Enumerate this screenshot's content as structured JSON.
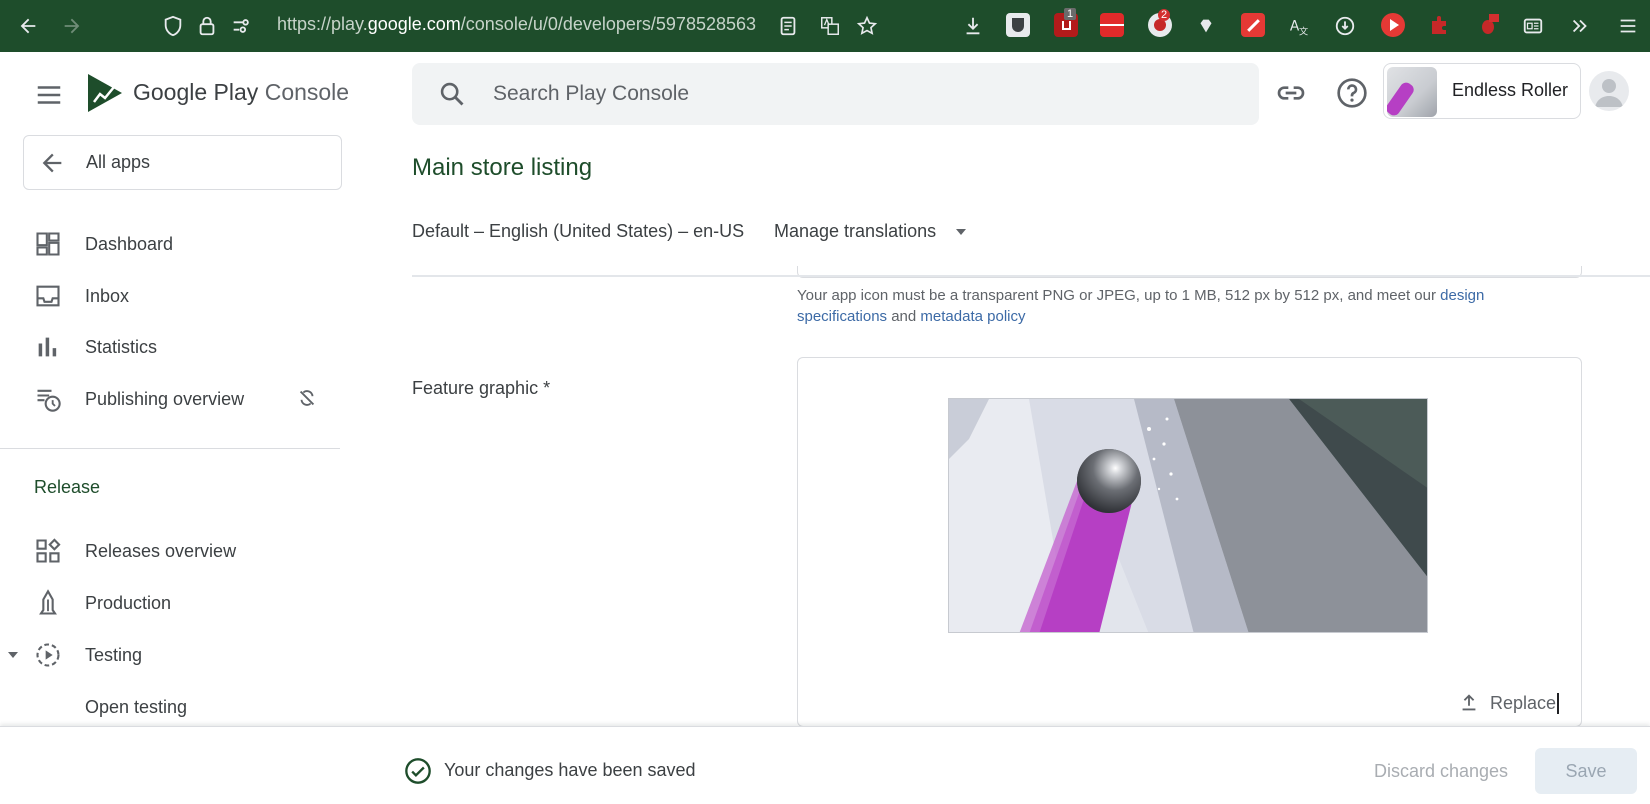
{
  "browser": {
    "url_prefix": "https://play.",
    "url_domain": "google.com",
    "url_path": "/console/u/0/developers/5978528563",
    "badges": {
      "ublock": "1",
      "ext_red": "2"
    }
  },
  "brand": {
    "logo_google": "Google Play",
    "logo_console": " Console"
  },
  "nav": {
    "all_apps": "All apps",
    "items": [
      {
        "label": "Dashboard",
        "icon": "dashboard-icon"
      },
      {
        "label": "Inbox",
        "icon": "inbox-icon"
      },
      {
        "label": "Statistics",
        "icon": "statistics-icon"
      },
      {
        "label": "Publishing overview",
        "icon": "publishing-overview-icon"
      }
    ],
    "release_section": "Release",
    "release_items": [
      {
        "label": "Releases overview",
        "icon": "releases-overview-icon"
      },
      {
        "label": "Production",
        "icon": "production-icon"
      },
      {
        "label": "Testing",
        "icon": "testing-icon"
      },
      {
        "label": "Open testing"
      }
    ]
  },
  "header": {
    "search_placeholder": "Search Play Console",
    "app_name": "Endless Roller"
  },
  "main": {
    "title": "Main store listing",
    "language": "Default – English (United States) – en-US",
    "manage_translations": "Manage translations",
    "icon_help_prefix": "Your app icon must be a transparent PNG or JPEG, up to 1 MB, 512 px by 512 px, and meet our ",
    "icon_help_link1": "design specifications",
    "icon_help_and": " and ",
    "icon_help_link2": "metadata policy",
    "feature_graphic_label": "Feature graphic  *",
    "replace_label": "Replace"
  },
  "footer": {
    "status": "Your changes have been saved",
    "discard": "Discard changes",
    "save": "Save"
  },
  "colors": {
    "brand_green": "#1e4d2b",
    "accent_purple": "#b63fc4"
  }
}
